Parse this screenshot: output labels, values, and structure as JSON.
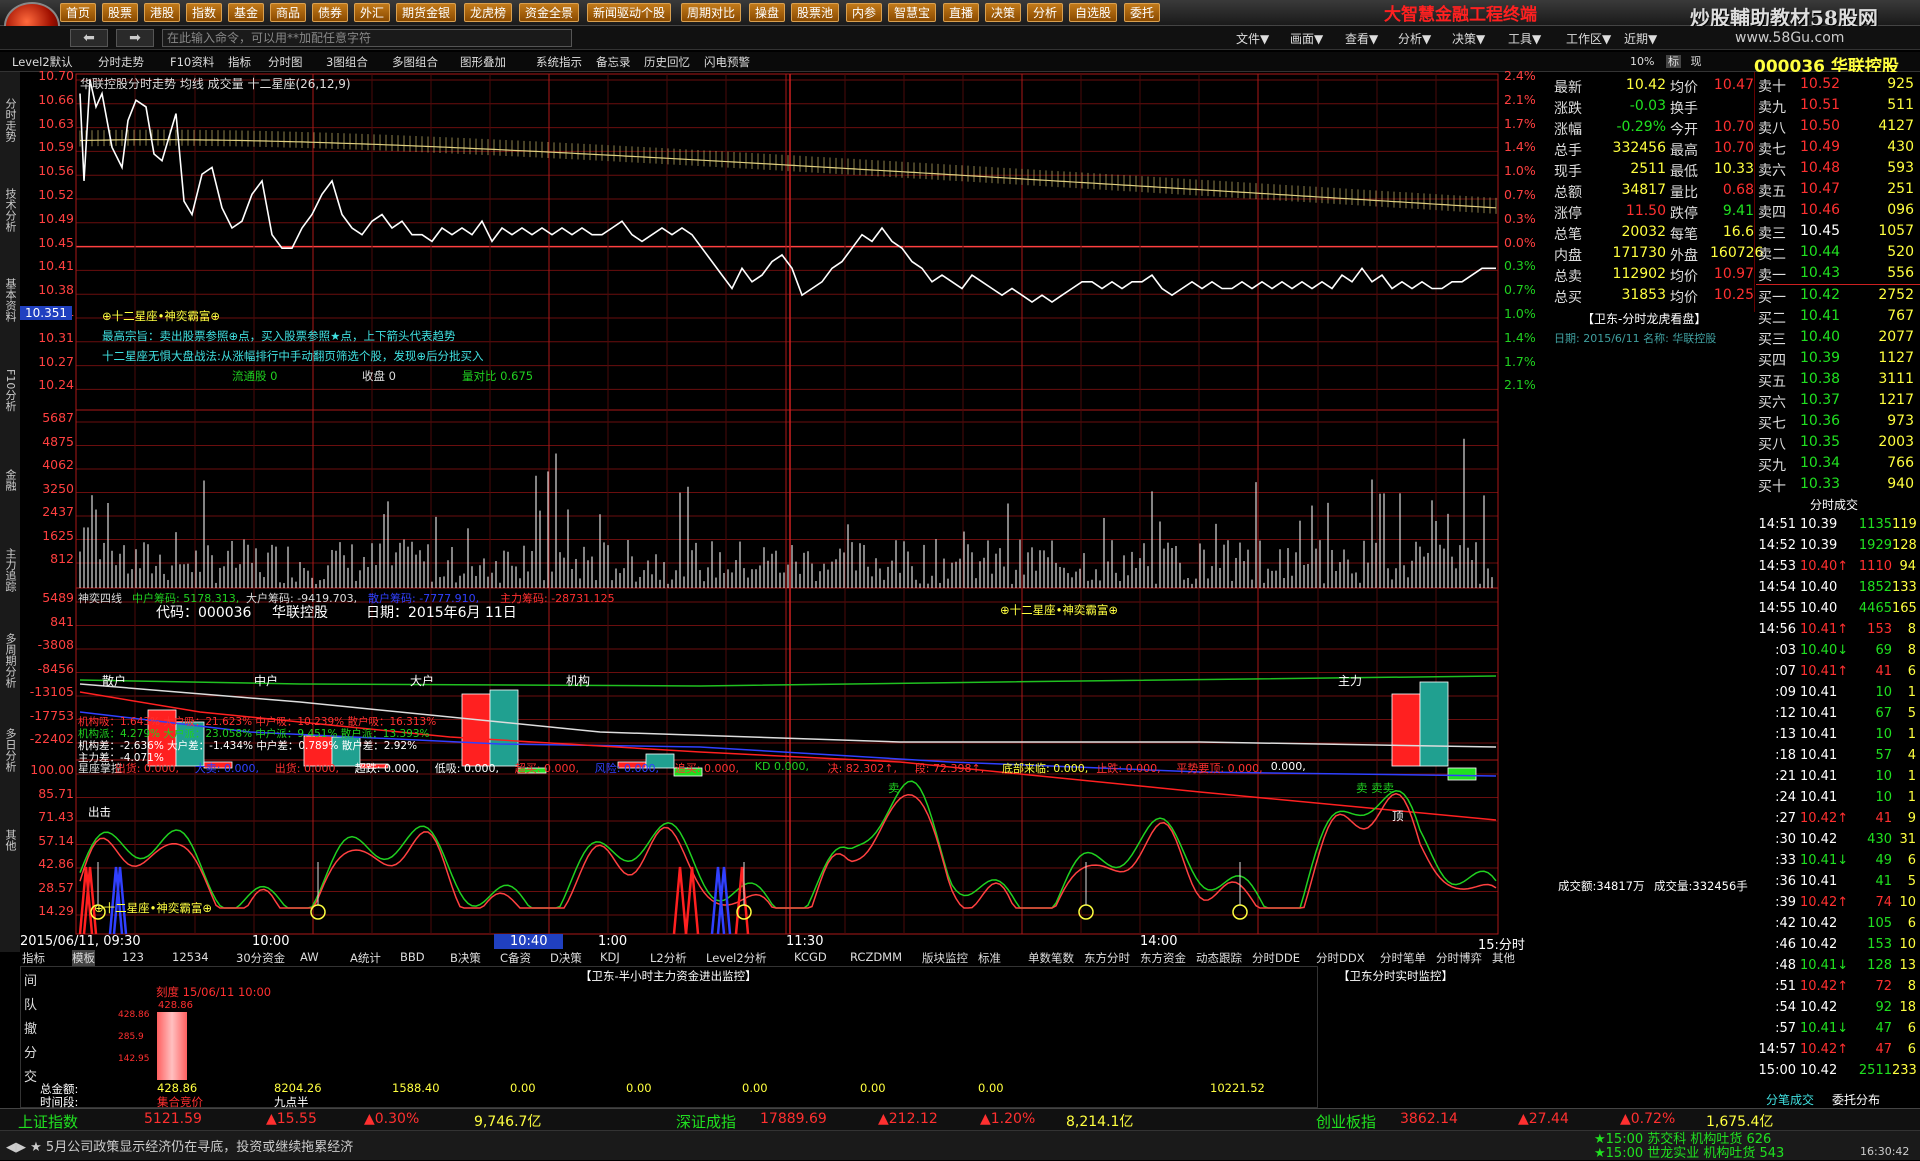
{
  "menu": [
    "首页",
    "股票",
    "港股",
    "指数",
    "基金",
    "商品",
    "债券",
    "外汇",
    "期货金银",
    "龙虎榜",
    "资金全景",
    "新闻驱动个股",
    "周期对比",
    "操盘",
    "股票池",
    "内参",
    "智慧宝",
    "直播",
    "决策",
    "分析",
    "自选股",
    "委托"
  ],
  "brand": "大智慧金融工程终端",
  "watermark": "炒股輔助教材58股网",
  "watermark_url": "www.58Gu.com",
  "command_placeholder": "在此输入命令，可以用**加配任意字符",
  "nav": [
    "文件▼",
    "画面▼",
    "查看▼",
    "分析▼",
    "决策▼",
    "工具▼",
    "工作区▼",
    "近期▼"
  ],
  "toolbar": [
    "Level2默认",
    "分时走势",
    "F10资料",
    "指标",
    "分时图",
    "3图组合",
    "多图组合",
    "图形叠加",
    "系统指示",
    "备忘录",
    "历史回忆",
    "闪电预警"
  ],
  "toolbar_right": [
    "10%",
    "标",
    "现"
  ],
  "stock_code": "000036",
  "stock_name": "华联控股",
  "left_tabs": [
    "分时走势",
    "技术分析",
    "基本资料",
    "F10分析",
    "金融",
    "主力追踪",
    "多周期分析",
    "多日分析",
    "其他"
  ],
  "chart_title": "华联控股分时走势  均线  成交量  十二星座(26,12,9)",
  "price_left": [
    "10.70",
    "10.66",
    "10.63",
    "10.59",
    "10.56",
    "10.52",
    "10.49",
    "10.45",
    "10.41",
    "10.38",
    "10.34",
    "10.31",
    "10.27",
    "10.24"
  ],
  "pct_right": [
    "2.4%",
    "2.1%",
    "1.7%",
    "1.4%",
    "1.0%",
    "0.7%",
    "0.3%",
    "0.0%",
    "0.3%",
    "0.7%",
    "1.0%",
    "1.4%",
    "1.7%",
    "2.1%"
  ],
  "current_price_tag": "10.351",
  "vol_left": [
    "5687",
    "4875",
    "4062",
    "3250",
    "2437",
    "1625",
    "812"
  ],
  "overlay_lines": [
    "⊕十二星座•神奕霸富⊕",
    "最高宗旨：卖出股票参照⊕点，买入股票参照★点，上下箭头代表趋势",
    "十二星座无惧大盘战法:从涨幅排行中手动翻页筛选个股，发现⊕后分批买入"
  ],
  "overlay_stats": {
    "label1": "流通股",
    "v1": "0",
    "label2": "收盘",
    "v2": "0",
    "label3": "量对比",
    "v3": "0.675"
  },
  "flow_header": {
    "title": "神奕四线",
    "a": "中户筹码: 5178.313,",
    "b": "大户筹码: -9419.703,",
    "c": "散户筹码: -7777.910,",
    "d": "主力筹码: -28731.125"
  },
  "flow_left": [
    "5489",
    "841",
    "-3808",
    "-8456",
    "-13105",
    "-17753",
    "-22402"
  ],
  "flow_info": {
    "code_label": "代码：000036",
    "name": "华联控股",
    "date_label": "日期：2015年6月 11日",
    "badge": "⊕十二星座•神奕霸富⊕"
  },
  "flow_groups": [
    "散户",
    "中户",
    "大户",
    "机构",
    "主力"
  ],
  "flow_stats": [
    "机构吸：1.643%  大户吸：21.623%  中户吸：10.239%  散户吸：16.313%",
    "机构派：4.279%  大户派：23.058%  中户派：9.451%  散户派：13.393%",
    "机构差：-2.636%  大户差：-1.434%  中户差：0.789%  散户差：2.92%",
    "主力差：-4.071%"
  ],
  "osc_header": [
    "星座掌控",
    "出货: 0.000,",
    "大卖: 0.000,",
    "出货: 0.000,",
    "超跌: 0.000,",
    "低吸: 0.000,",
    "超买: 0.000,",
    "风险: 0.000,",
    "追买: 0.000,",
    "KD 0.000,",
    "决: 82.302↑,",
    "段: 72.398↑,",
    "底部来临: 0.000,",
    "止跌: 0.000,",
    "平势要顶: 0.000,",
    "0.000,"
  ],
  "osc_left": [
    "100.00",
    "85.71",
    "71.43",
    "57.14",
    "42.86",
    "28.57",
    "14.29"
  ],
  "osc_labels": {
    "out": "出击",
    "sell1": "卖",
    "sell2": "卖 卖卖",
    "top": "顶",
    "star": "⊕十二星座•神奕霸富⊕"
  },
  "time_axis": [
    "2015/06/11, 09:30",
    "10:00",
    "10:40",
    "1:00",
    "11:30",
    "14:00",
    "15:分时"
  ],
  "indicator_tabs": [
    "指标",
    "模板",
    "123",
    "12534",
    "30分资金",
    "AW",
    "A统计",
    "BBD",
    "B决策",
    "C备资",
    "D决策",
    "KDJ",
    "L2分析",
    "Level2分析",
    "KCGD",
    "RCZDMM",
    "版块监控",
    "标准",
    "单数笔数",
    "东方分时",
    "东方资金",
    "动态跟踪",
    "分时DDE",
    "分时DDX",
    "分时笔单",
    "分时博弈",
    "其他"
  ],
  "bottom_panel": {
    "title": "【卫东-半小时主力资金进出监控】",
    "title2": "【卫东分时实时监控】",
    "side": [
      "间",
      "队",
      "撤",
      "分",
      "交"
    ],
    "label_total": "总金额:",
    "label_time": "时间段:",
    "values": [
      "428.86",
      "8204.26",
      "1588.40",
      "0.00",
      "0.00",
      "0.00",
      "0.00",
      "0.00",
      "10221.52"
    ],
    "segments": [
      "集合竞价",
      "九点半"
    ],
    "bar_top": "428.86",
    "bar_ticks": [
      "428.86",
      "285.9",
      "142.95"
    ],
    "legend": "刻度 15/06/11 10:00"
  },
  "quote": {
    "rows": [
      [
        "最新",
        "10.42",
        "均价",
        "10.47"
      ],
      [
        "涨跌",
        "-0.03",
        "换手",
        ""
      ],
      [
        "涨幅",
        "-0.29%",
        "今开",
        "10.70"
      ],
      [
        "总手",
        "332456",
        "最高",
        "10.70"
      ],
      [
        "现手",
        "2511",
        "最低",
        "10.33"
      ],
      [
        "总额",
        "34817",
        "量比",
        "0.68"
      ],
      [
        "涨停",
        "11.50",
        "跌停",
        "9.41"
      ],
      [
        "总笔",
        "20032",
        "每笔",
        "16.6"
      ],
      [
        "内盘",
        "171730",
        "外盘",
        "160726"
      ],
      [
        "总卖",
        "112902",
        "均价",
        "10.97"
      ],
      [
        "总买",
        "31853",
        "均价",
        "10.25"
      ]
    ],
    "dragon": "【卫东-分时龙虎看盘】",
    "dragon_date": "日期: 2015/6/11    名称: 华联控股",
    "deal_hdr": [
      "成交额:34817万",
      "成交量:332456手"
    ]
  },
  "book": {
    "sell": [
      [
        "卖十",
        "10.52",
        "925"
      ],
      [
        "卖九",
        "10.51",
        "511"
      ],
      [
        "卖八",
        "10.50",
        "4127"
      ],
      [
        "卖七",
        "10.49",
        "430"
      ],
      [
        "卖六",
        "10.48",
        "593"
      ],
      [
        "卖五",
        "10.47",
        "251"
      ],
      [
        "卖四",
        "10.46",
        "096"
      ],
      [
        "卖三",
        "10.45",
        "1057"
      ],
      [
        "卖二",
        "10.44",
        "520"
      ],
      [
        "卖一",
        "10.43",
        "556"
      ]
    ],
    "buy": [
      [
        "买一",
        "10.42",
        "2752"
      ],
      [
        "买二",
        "10.41",
        "767"
      ],
      [
        "买三",
        "10.40",
        "2077"
      ],
      [
        "买四",
        "10.39",
        "1127"
      ],
      [
        "买五",
        "10.38",
        "3111"
      ],
      [
        "买六",
        "10.37",
        "1217"
      ],
      [
        "买七",
        "10.36",
        "973"
      ],
      [
        "买八",
        "10.35",
        "2003"
      ],
      [
        "买九",
        "10.34",
        "766"
      ],
      [
        "买十",
        "10.33",
        "940"
      ]
    ]
  },
  "ticks_header": "分时成交",
  "ticks": [
    [
      "14:51",
      "10.39",
      "1135",
      "119"
    ],
    [
      "14:52",
      "10.39",
      "1929",
      "128"
    ],
    [
      "14:53",
      "10.40↑",
      "1110",
      "94"
    ],
    [
      "14:54",
      "10.40",
      "1852",
      "133"
    ],
    [
      "14:55",
      "10.40",
      "4465",
      "165"
    ],
    [
      "14:56",
      "10.41↑",
      "153",
      "8"
    ],
    [
      ":03",
      "10.40↓",
      "69",
      "8"
    ],
    [
      ":07",
      "10.41↑",
      "41",
      "6"
    ],
    [
      ":09",
      "10.41",
      "10",
      "1"
    ],
    [
      ":12",
      "10.41",
      "67",
      "5"
    ],
    [
      ":13",
      "10.41",
      "10",
      "1"
    ],
    [
      ":18",
      "10.41",
      "57",
      "4"
    ],
    [
      ":21",
      "10.41",
      "10",
      "1"
    ],
    [
      ":24",
      "10.41",
      "10",
      "1"
    ],
    [
      ":27",
      "10.42↑",
      "41",
      "9"
    ],
    [
      ":30",
      "10.42",
      "430",
      "31"
    ],
    [
      ":33",
      "10.41↓",
      "49",
      "6"
    ],
    [
      ":36",
      "10.41",
      "41",
      "5"
    ],
    [
      ":39",
      "10.42↑",
      "74",
      "10"
    ],
    [
      ":42",
      "10.42",
      "105",
      "6"
    ],
    [
      ":46",
      "10.42",
      "153",
      "10"
    ],
    [
      ":48",
      "10.41↓",
      "128",
      "13"
    ],
    [
      ":51",
      "10.42↑",
      "72",
      "8"
    ],
    [
      ":54",
      "10.42",
      "92",
      "18"
    ],
    [
      ":57",
      "10.41↓",
      "47",
      "6"
    ],
    [
      "14:57",
      "10.42↑",
      "47",
      "6"
    ],
    [
      "15:00",
      "10.42",
      "2511",
      "233"
    ]
  ],
  "right_tabs": [
    "分笔成交",
    "委托分布"
  ],
  "indices": [
    {
      "name": "上证指数",
      "v": "5121.59",
      "ch": "▲15.55",
      "pct": "▲0.30%",
      "amt": "9,746.7亿"
    },
    {
      "name": "深证成指",
      "v": "17889.69",
      "ch": "▲212.12",
      "pct": "▲1.20%",
      "amt": "8,214.1亿"
    },
    {
      "name": "创业板指",
      "v": "3862.14",
      "ch": "▲27.44",
      "pct": "▲0.72%",
      "amt": "1,675.4亿"
    }
  ],
  "ticker_msg": "5月公司政策显示经济仍在寻底，投资或继续拖累经济",
  "news": [
    "15:00 苏交科   机构吐货 626",
    "15:00 世龙实业 机构吐货 543"
  ],
  "clock": "16:30:42",
  "colors": {
    "up": "#ff3030",
    "down": "#20e020",
    "grid": "#8a1010",
    "accent": "#ffff40"
  }
}
